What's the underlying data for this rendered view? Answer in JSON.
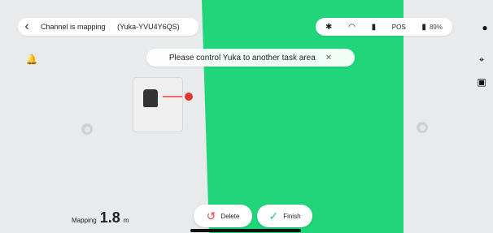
{
  "top": {
    "title": "Channel is mapping",
    "device": "(Yuka-YVU4Y6QS)"
  },
  "status": {
    "pos_label": "POS",
    "battery_pct": "89%"
  },
  "toast": {
    "message": "Please control Yuka to another task area"
  },
  "bottom": {
    "mapping_label": "Mapping",
    "mapping_value": "1.8",
    "mapping_unit": "m"
  },
  "actions": {
    "delete_label": "Delete",
    "finish_label": "Finish"
  },
  "colors": {
    "grass": "#21d67a",
    "delete": "#e24b4b",
    "finish": "#2ecc71"
  }
}
